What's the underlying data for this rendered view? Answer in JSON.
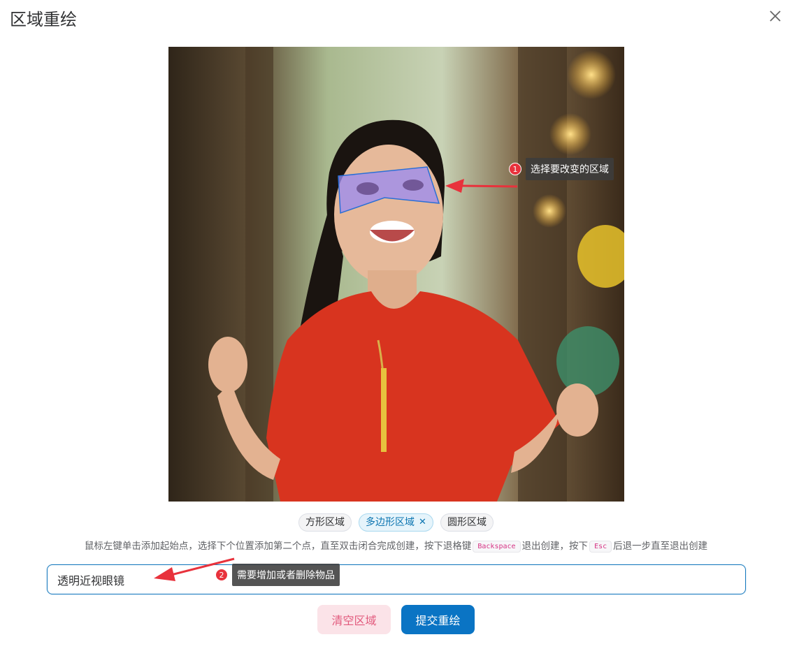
{
  "dialog": {
    "title": "区域重绘"
  },
  "image": {
    "description_icon": "portrait-photo"
  },
  "region_tabs": [
    {
      "label": "方形区域",
      "active": false
    },
    {
      "label": "多边形区域",
      "active": true,
      "close_glyph": "✕"
    },
    {
      "label": "圆形区域",
      "active": false
    }
  ],
  "hint": {
    "part1": "鼠标左键单击添加起始点，选择下个位置添加第二个点，直至双击闭合完成创建，按下退格键",
    "key1": "Backspace",
    "part2": "退出创建，按下",
    "key2": "Esc",
    "part3": "后退一步直至退出创建"
  },
  "prompt": {
    "value": "透明近视眼镜"
  },
  "buttons": {
    "clear": "清空区域",
    "submit": "提交重绘"
  },
  "annotations": [
    {
      "number": "1",
      "text": "选择要改变的区域"
    },
    {
      "number": "2",
      "text": "需要增加或者删除物品"
    }
  ],
  "colors": {
    "accent": "#0a74c4",
    "clear_bg": "#fbe3e8",
    "clear_text": "#e25a7d",
    "annotation_badge": "#e8323c",
    "polygon_fill": "#9b8cf0",
    "polygon_stroke": "#2a6fd6"
  }
}
